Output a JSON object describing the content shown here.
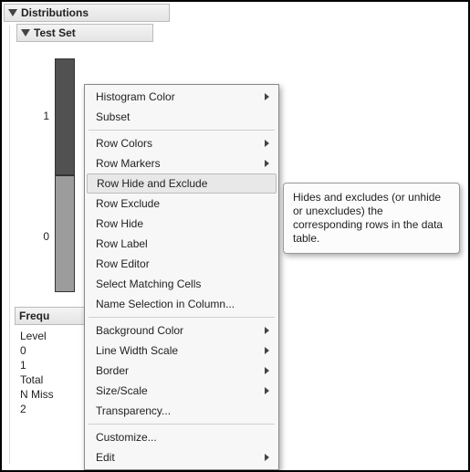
{
  "header": {
    "title": "Distributions",
    "subtitle": "Test Set"
  },
  "histogram": {
    "ticks": [
      "1",
      "0"
    ]
  },
  "frequencies": {
    "title": "Frequ",
    "rows": [
      "Level",
      "0",
      "1",
      "Total",
      "N Miss",
      "    2"
    ]
  },
  "menu": {
    "items": [
      {
        "label": "Histogram Color",
        "submenu": true
      },
      {
        "label": "Subset"
      },
      {
        "sep": true
      },
      {
        "label": "Row Colors",
        "submenu": true
      },
      {
        "label": "Row Markers",
        "submenu": true
      },
      {
        "label": "Row Hide and Exclude",
        "highlight": true
      },
      {
        "label": "Row Exclude"
      },
      {
        "label": "Row Hide"
      },
      {
        "label": "Row Label"
      },
      {
        "label": "Row Editor"
      },
      {
        "label": "Select Matching Cells"
      },
      {
        "label": "Name Selection in Column..."
      },
      {
        "sep": true
      },
      {
        "label": "Background Color",
        "submenu": true
      },
      {
        "label": "Line Width Scale",
        "submenu": true
      },
      {
        "label": "Border",
        "submenu": true
      },
      {
        "label": "Size/Scale",
        "submenu": true
      },
      {
        "label": "Transparency..."
      },
      {
        "sep": true
      },
      {
        "label": "Customize..."
      },
      {
        "label": "Edit",
        "submenu": true
      }
    ]
  },
  "tooltip": {
    "text": "Hides and excludes (or unhide or unexcludes) the corresponding rows in the data table."
  },
  "chart_data": {
    "type": "bar",
    "orientation": "vertical-categorical",
    "categories": [
      "1",
      "0"
    ],
    "values": [
      null,
      null
    ],
    "note": "two equal-height stacked category blocks, values not labeled",
    "title": "Test Set",
    "xlabel": "",
    "ylabel": ""
  }
}
